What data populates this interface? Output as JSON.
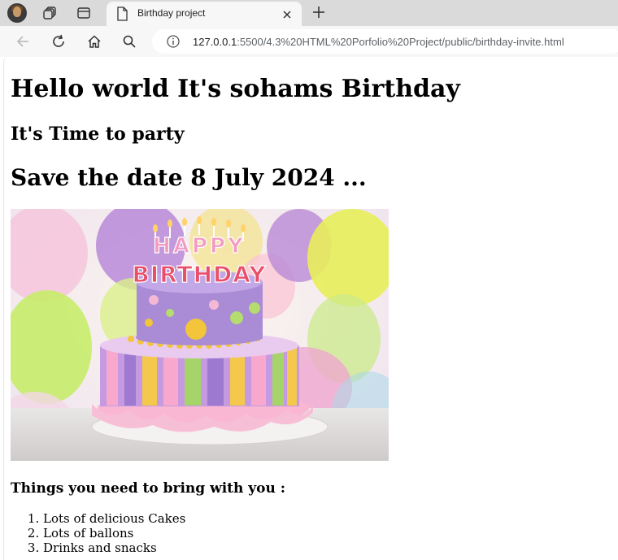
{
  "tab": {
    "title": "Birthday project",
    "close_glyph": "✕"
  },
  "toolbar": {
    "url_host": "127.0.0.1",
    "url_rest": ":5500/4.3%20HTML%20Porfolio%20Project/public/birthday-invite.html"
  },
  "icons": {
    "profile": "profile-avatar",
    "workspaces": "workspaces-icon",
    "tab_actions": "tab-actions-icon",
    "favicon": "page-icon",
    "back": "back-arrow-icon",
    "reload": "reload-icon",
    "home": "home-icon",
    "search": "search-icon",
    "info": "info-icon",
    "new_tab": "plus-icon"
  },
  "page": {
    "heading": "Hello world It's sohams Birthday",
    "subheading": "It's Time to party",
    "save_date": "Save the date 8 July 2024 ...",
    "bring_heading": "Things you need to bring with you :",
    "bring_items": [
      "Lots of delicious Cakes",
      "Lots of ballons",
      "Drinks and snacks"
    ],
    "cake_topper": [
      "HAPPY",
      "BIRTHDAY"
    ]
  },
  "colors": {
    "tabstrip": "#dadada",
    "toolbar": "#f7f7f7",
    "cake_purple": "#a98bd6",
    "cake_pink": "#f4a9c9",
    "balloon_yellow": "#e8ee6a",
    "balloon_green": "#b6e37a"
  }
}
